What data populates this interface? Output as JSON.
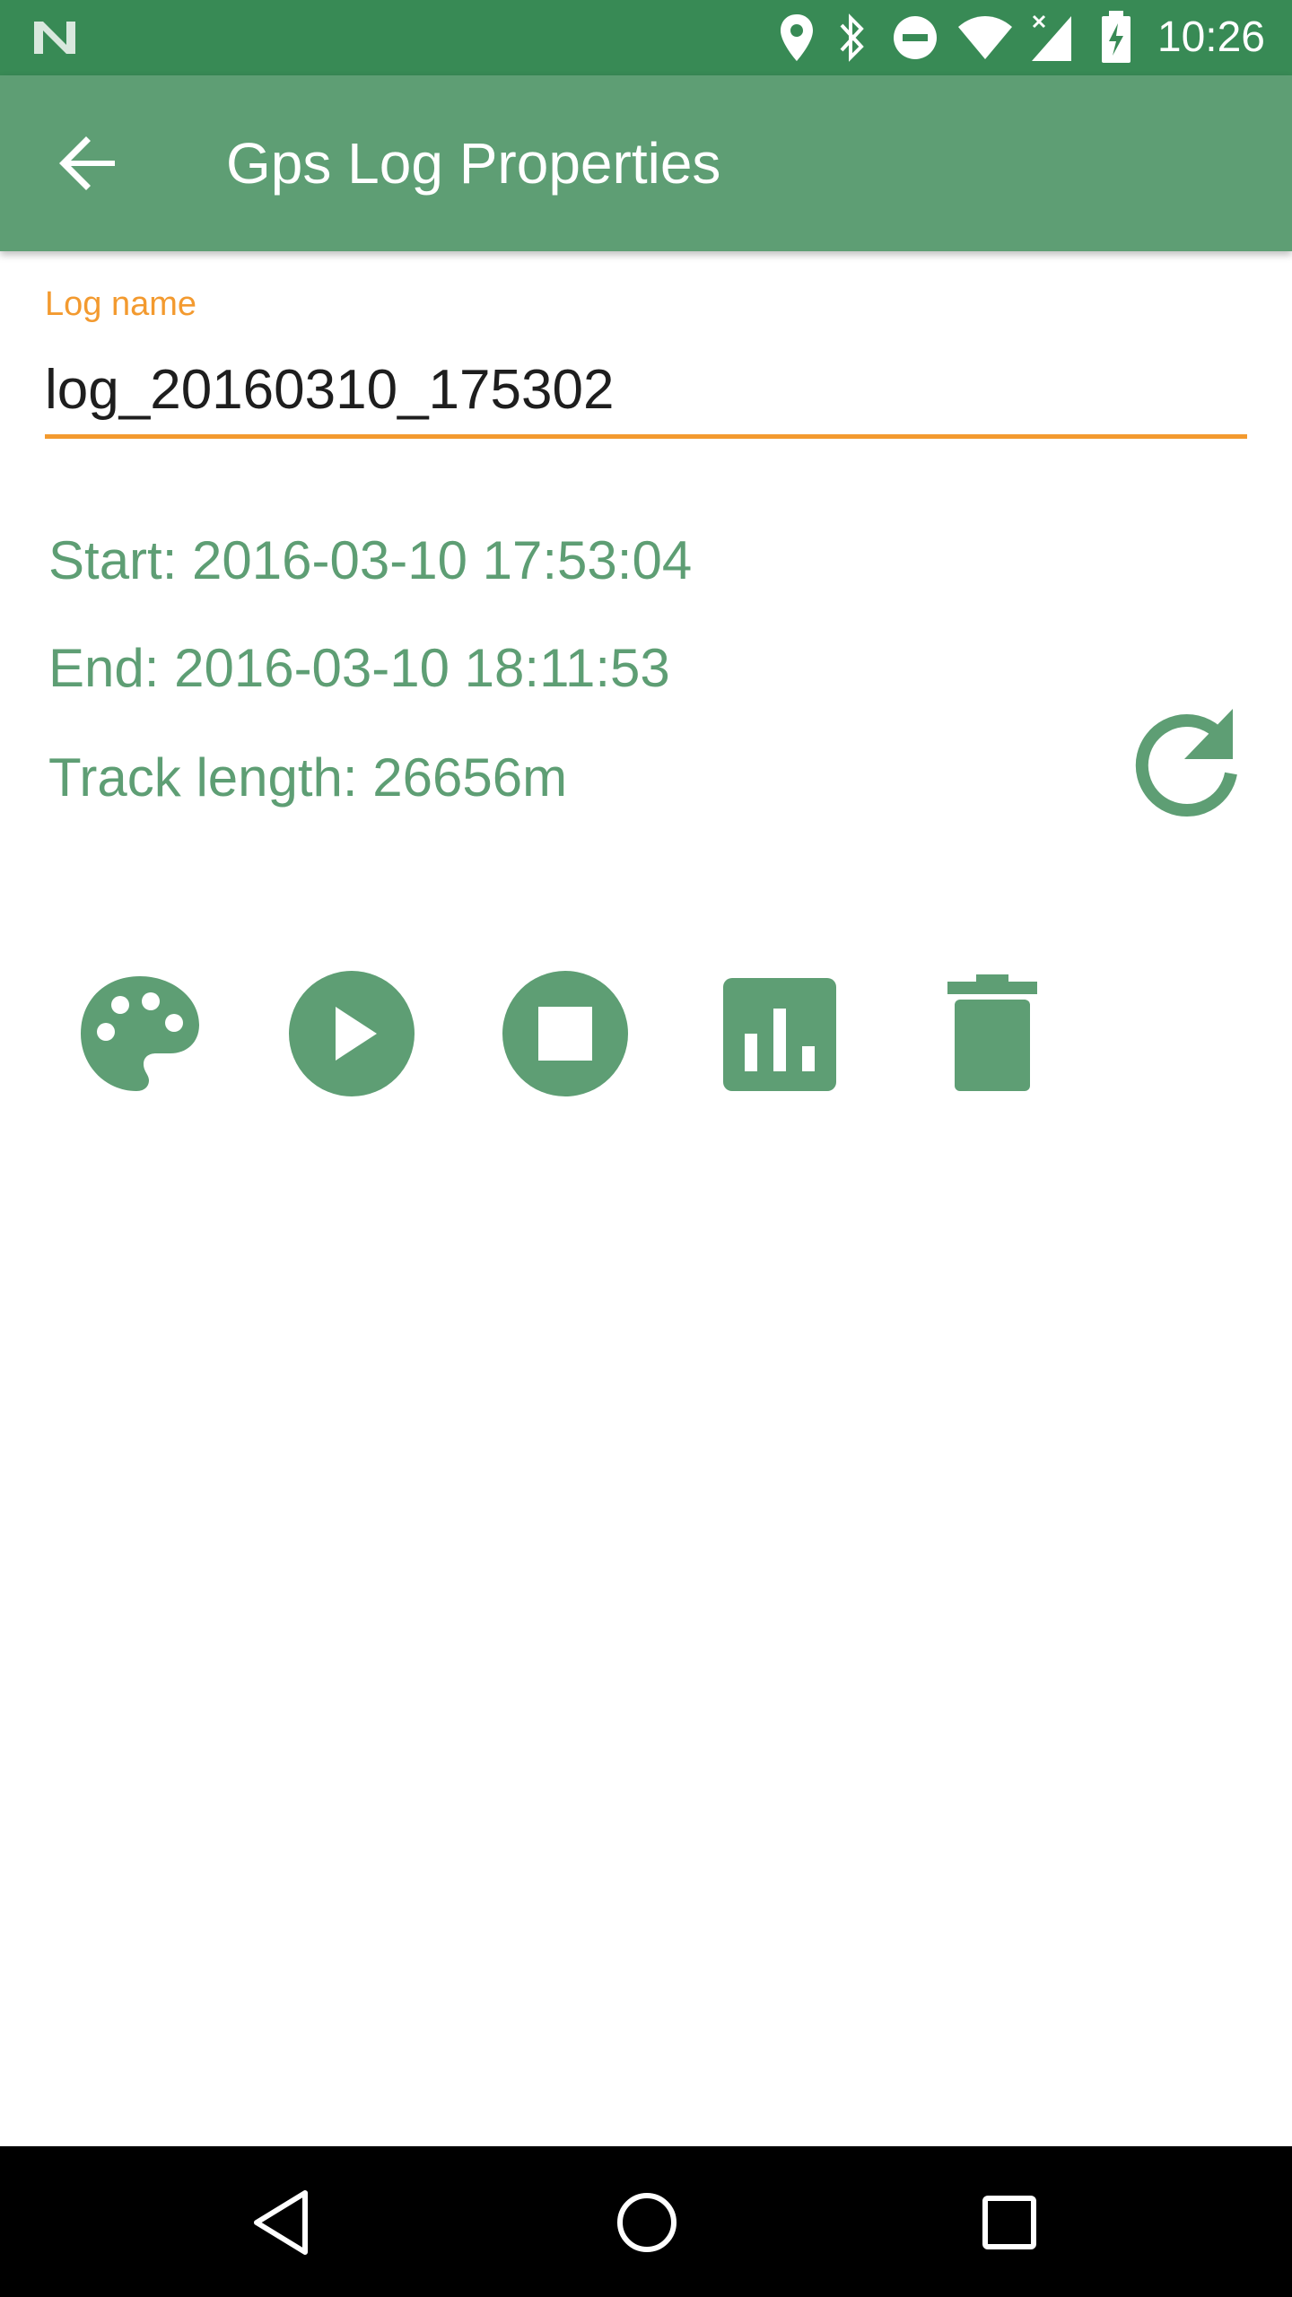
{
  "status_bar": {
    "time": "10:26",
    "icons": [
      "notification-n-icon",
      "location-icon",
      "bluetooth-icon",
      "do-not-disturb-icon",
      "wifi-icon",
      "signal-icon",
      "battery-icon"
    ]
  },
  "app_bar": {
    "title": "Gps Log Properties",
    "back_icon": "arrow-back-icon"
  },
  "form": {
    "log_name_label": "Log name",
    "log_name_value": "log_20160310_175302"
  },
  "info": {
    "start": "Start: 2016-03-10 17:53:04",
    "end": "End: 2016-03-10 18:11:53",
    "track_length": "Track length: 26656m"
  },
  "actions": {
    "refresh_icon": "refresh-icon",
    "buttons": [
      "palette-icon",
      "play-icon",
      "stop-icon",
      "chart-icon",
      "delete-icon"
    ]
  },
  "nav_bar": {
    "buttons": [
      "back-triangle-icon",
      "home-circle-icon",
      "recents-square-icon"
    ]
  },
  "colors": {
    "status_bar": "#388a55",
    "app_bar": "#5e9e74",
    "accent": "#f39a2f",
    "icon_green": "#5e9e74",
    "nav_bar": "#000000"
  }
}
